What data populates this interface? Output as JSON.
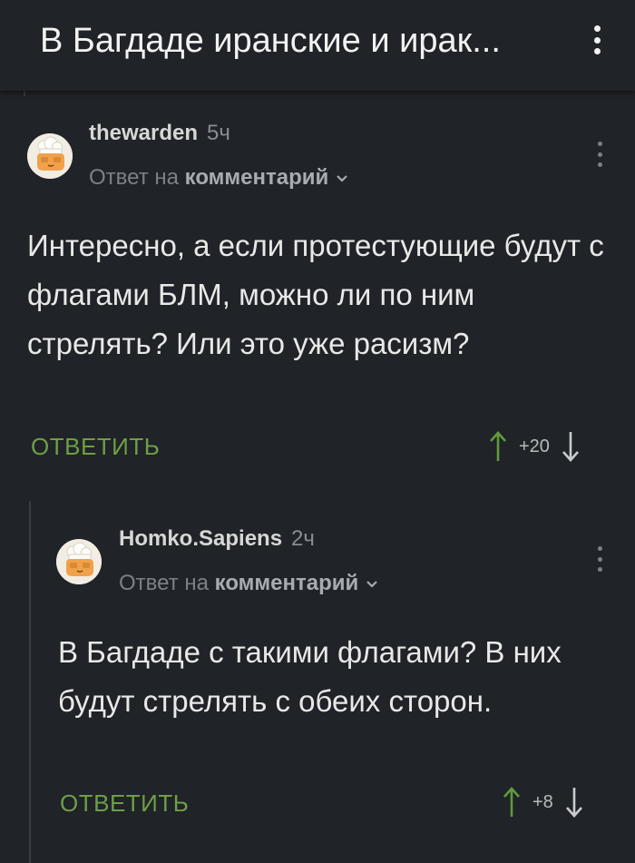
{
  "header": {
    "title": "В Багдаде иранские и ирак..."
  },
  "comments": [
    {
      "username": "thewarden",
      "time": "5ч",
      "reply_prefix": "Ответ на",
      "reply_target": "комментарий",
      "text": "Интересно, а если протестующие будут с флагами БЛМ, можно ли по ним стрелять? Или это уже расизм?",
      "reply_label": "ОТВЕТИТЬ",
      "score": "+20"
    },
    {
      "username": "Homko.Sapiens",
      "time": "2ч",
      "reply_prefix": "Ответ на",
      "reply_target": "комментарий",
      "text": "В Багдаде с такими флагами? В них будут стрелять с обеих сторон.",
      "reply_label": "ОТВЕТИТЬ",
      "score": "+8"
    }
  ],
  "colors": {
    "background": "#202327",
    "accent_green": "#6c9f47",
    "upvote": "#5f9a3c",
    "downvote": "#c9cbcf"
  },
  "icons": {
    "overflow": "kebab-menu-icon",
    "avatar": "chef-hat-avatar-icon",
    "chevron": "chevron-down-icon",
    "upvote": "arrow-up-icon",
    "downvote": "arrow-down-icon"
  }
}
